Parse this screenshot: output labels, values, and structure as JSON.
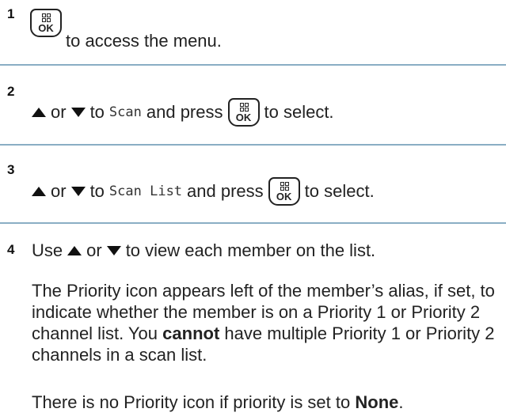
{
  "steps": [
    {
      "number": "1",
      "text_after_button": "to access the menu."
    },
    {
      "number": "2",
      "or": "or",
      "to": "to",
      "menu_item": "Scan",
      "and_press": "and press",
      "to_select": "to select."
    },
    {
      "number": "3",
      "or": "or",
      "to": "to",
      "menu_item": "Scan List",
      "and_press": "and press",
      "to_select": "to select."
    },
    {
      "number": "4",
      "use": "Use",
      "or": "or",
      "instruction_end": "to view each member on the list.",
      "para1_start": "The Priority icon appears left of the member’s alias, if set, to indicate whether the member is on a Priority 1 or Priority 2 channel list. You",
      "para1_bold": "cannot",
      "para1_end": "have multiple Priority 1 or Priority 2 channels in a scan list.",
      "para2_start": "There is no Priority icon if priority is set to",
      "para2_bold": "None",
      "para2_end": "."
    }
  ],
  "ok_button_label": "OK",
  "icons": {
    "ok": "menu-ok-button-icon",
    "up": "up-arrow-icon",
    "down": "down-arrow-icon"
  },
  "colors": {
    "separator": "#8aaec4",
    "text": "#222222"
  }
}
